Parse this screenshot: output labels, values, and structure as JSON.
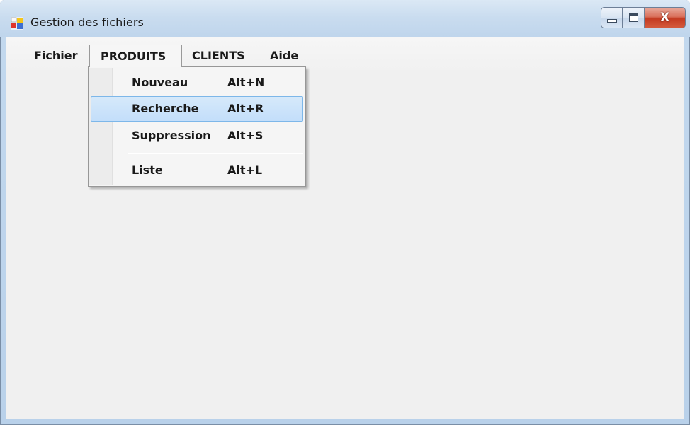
{
  "window": {
    "title": "Gestion des fichiers",
    "close_label": "X"
  },
  "menubar": {
    "items": [
      {
        "label": "Fichier"
      },
      {
        "label": "PRODUITS"
      },
      {
        "label": "CLIENTS"
      },
      {
        "label": "Aide"
      }
    ]
  },
  "dropdown": {
    "items": [
      {
        "label": "Nouveau",
        "shortcut": "Alt+N"
      },
      {
        "label": "Recherche",
        "shortcut": "Alt+R"
      },
      {
        "label": "Suppression",
        "shortcut": "Alt+S"
      },
      {
        "label": "Liste",
        "shortcut": "Alt+L"
      }
    ],
    "highlighted": "Recherche"
  },
  "colors": {
    "highlight": "#c3defa",
    "highlight_border": "#7db7e9",
    "client_bg": "#f0f0f0",
    "close_button": "#c43b22"
  },
  "icons": {
    "app": "application-window-icon",
    "minimize": "minimize-icon",
    "maximize": "maximize-icon",
    "close": "close-icon"
  }
}
